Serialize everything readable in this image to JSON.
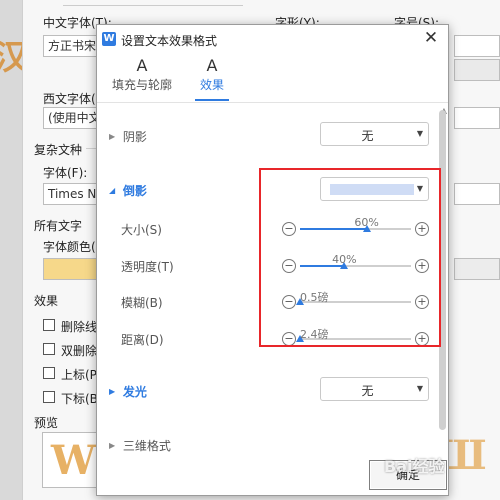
{
  "background_dialog": {
    "cn_font_label": "中文字体(T):",
    "cn_font_value": "方正书宋",
    "style_label": "字形(Y):",
    "size_label": "字号(S):",
    "west_font_label": "西文字体(",
    "west_font_value": "(使用中文",
    "complex_label": "复杂文种",
    "complex_font_label": "字体(F):",
    "complex_font_value": "Times N",
    "all_text_label": "所有文字",
    "font_color_label": "字体颜色(",
    "effects_label": "效果",
    "effects": [
      "删除线",
      "双删除",
      "上标(P",
      "下标(B"
    ],
    "preview_label": "预览",
    "preview_glyph": "W"
  },
  "dialog": {
    "title": "设置文本效果格式",
    "app_icon": "W",
    "tabs": [
      {
        "label": "填充与轮廓",
        "icon": "text-fill-icon",
        "glyph": "A"
      },
      {
        "label": "效果",
        "icon": "text-effect-icon",
        "glyph": "A"
      }
    ],
    "sections": {
      "shadow": {
        "title": "阴影",
        "value": "无"
      },
      "reflection": {
        "title": "倒影"
      },
      "glow": {
        "title": "发光",
        "value": "无"
      },
      "threed": {
        "title": "三维格式"
      }
    },
    "reflection_settings": [
      {
        "label": "大小(S)",
        "value_text": "60%",
        "fraction": 0.6
      },
      {
        "label": "透明度(T)",
        "value_text": "40%",
        "fraction": 0.4
      },
      {
        "label": "模糊(B)",
        "value_text": "0.5磅",
        "fraction": 0.0
      },
      {
        "label": "距离(D)",
        "value_text": "2.4磅",
        "fraction": 0.0
      }
    ],
    "ok_label": "确定"
  },
  "watermark": "Bai经验",
  "colors": {
    "accent": "#2f7be0",
    "highlight": "#e8262a",
    "reflection_swatch": "#cfdcf5",
    "font_color": "#f6d88a"
  }
}
